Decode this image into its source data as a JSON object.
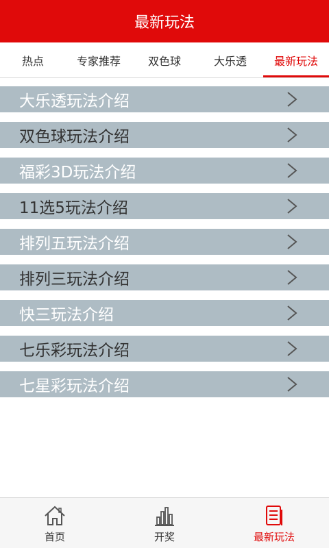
{
  "header": {
    "title": "最新玩法"
  },
  "tabs": [
    {
      "label": "热点"
    },
    {
      "label": "专家推荐"
    },
    {
      "label": "双色球"
    },
    {
      "label": "大乐透"
    },
    {
      "label": "最新玩法"
    }
  ],
  "active_tab": "最新玩法",
  "list": {
    "items": [
      {
        "label": "大乐透玩法介绍"
      },
      {
        "label": "双色球玩法介绍"
      },
      {
        "label": "福彩3D玩法介绍"
      },
      {
        "label": "11选5玩法介绍"
      },
      {
        "label": "排列五玩法介绍"
      },
      {
        "label": "排列三玩法介绍"
      },
      {
        "label": "快三玩法介绍"
      },
      {
        "label": "七乐彩玩法介绍"
      },
      {
        "label": "七星彩玩法介绍"
      }
    ]
  },
  "bottom_nav": [
    {
      "label": "首页",
      "icon": "home-icon"
    },
    {
      "label": "开奖",
      "icon": "bar-chart-icon"
    },
    {
      "label": "最新玩法",
      "icon": "document-icon"
    }
  ],
  "colors": {
    "accent": "#e00a0a",
    "list_bg": "#aebcc4"
  }
}
